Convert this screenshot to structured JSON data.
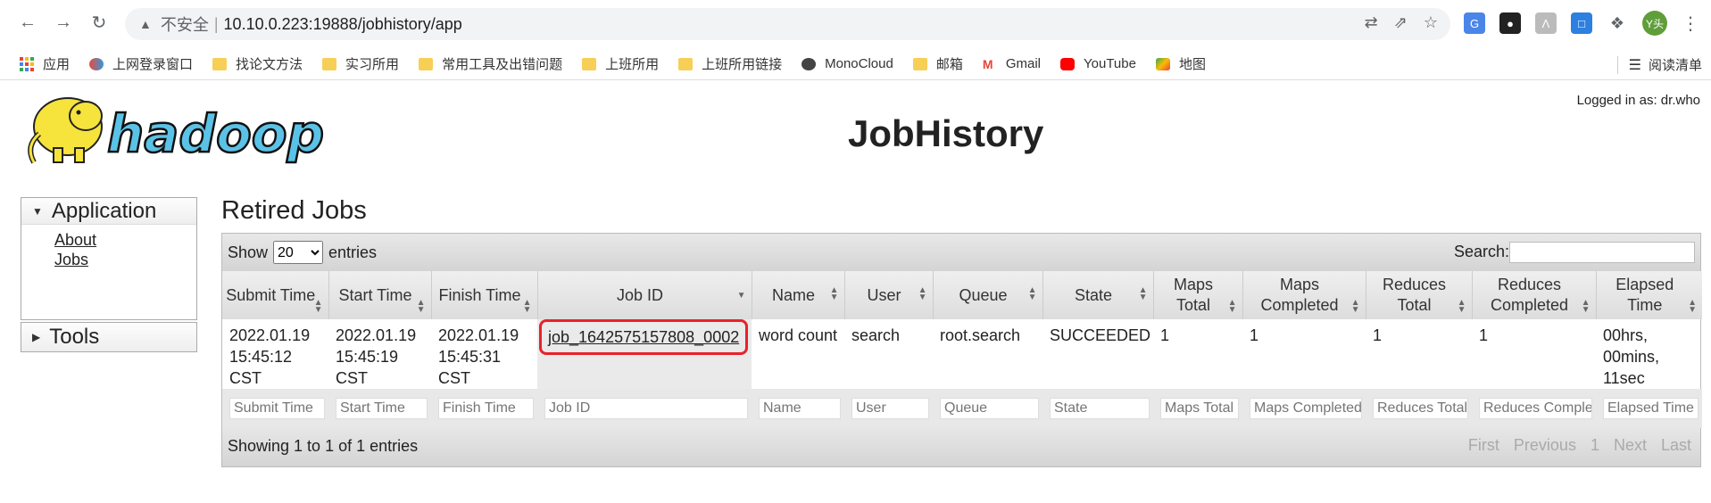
{
  "browser": {
    "insecure_label": "不安全",
    "url": "10.10.0.223:19888/jobhistory/app",
    "avatar_label": "Y头"
  },
  "bookmarks": [
    {
      "label": "应用",
      "icon": "apps-grid-icon"
    },
    {
      "label": "上网登录窗口",
      "icon": "colorful-icon"
    },
    {
      "label": "找论文方法",
      "icon": "folder-icon"
    },
    {
      "label": "实习所用",
      "icon": "folder-icon"
    },
    {
      "label": "常用工具及出错问题",
      "icon": "folder-icon"
    },
    {
      "label": "上班所用",
      "icon": "folder-icon"
    },
    {
      "label": "上班所用链接",
      "icon": "folder-icon"
    },
    {
      "label": "MonoCloud",
      "icon": "globe-icon"
    },
    {
      "label": "邮箱",
      "icon": "folder-icon"
    },
    {
      "label": "Gmail",
      "icon": "gmail-icon"
    },
    {
      "label": "YouTube",
      "icon": "youtube-icon"
    },
    {
      "label": "地图",
      "icon": "maps-icon"
    }
  ],
  "reading_list": "阅读清单",
  "header": {
    "logged_in": "Logged in as: dr.who",
    "title": "JobHistory",
    "logo_text": "hadoop"
  },
  "sidebar": {
    "application_title": "Application",
    "links": [
      "About",
      "Jobs"
    ],
    "tools_title": "Tools"
  },
  "section_title": "Retired Jobs",
  "table": {
    "show_label": "Show",
    "show_value": "20",
    "entries_label": "entries",
    "search_label": "Search:",
    "columns": [
      "Submit Time",
      "Start Time",
      "Finish Time",
      "Job ID",
      "Name",
      "User",
      "Queue",
      "State",
      "Maps Total",
      "Maps Completed",
      "Reduces Total",
      "Reduces Completed",
      "Elapsed Time"
    ],
    "rows": [
      [
        "2022.01.19 15:45:12 CST",
        "2022.01.19 15:45:19 CST",
        "2022.01.19 15:45:31 CST",
        "job_1642575157808_0002",
        "word count",
        "search",
        "root.search",
        "SUCCEEDED",
        "1",
        "1",
        "1",
        "1",
        "00hrs, 00mins, 11sec"
      ]
    ],
    "filter_placeholders": [
      "Submit Time",
      "Start Time",
      "Finish Time",
      "Job ID",
      "Name",
      "User",
      "Queue",
      "State",
      "Maps Total",
      "Maps Completed",
      "Reduces Total",
      "Reduces Completed",
      "Elapsed Time"
    ],
    "info": "Showing 1 to 1 of 1 entries",
    "pager": [
      "First",
      "Previous",
      "1",
      "Next",
      "Last"
    ]
  },
  "colors": {
    "highlight": "#e8222a",
    "logo_yellow": "#f6e33b",
    "logo_blue": "#5bc2e7"
  }
}
